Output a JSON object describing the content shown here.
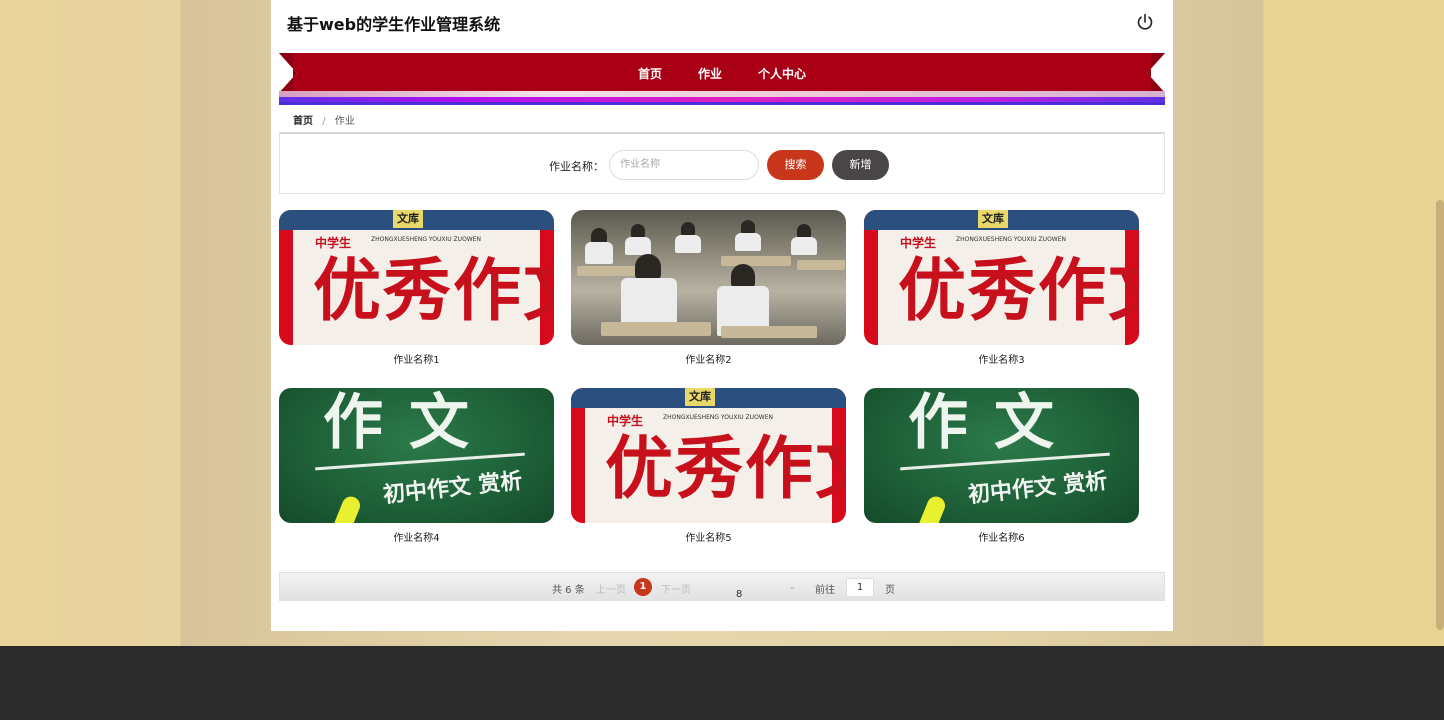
{
  "app": {
    "title": "基于web的学生作业管理系统"
  },
  "nav": {
    "items": [
      {
        "label": "首页",
        "active": false
      },
      {
        "label": "作业",
        "active": true
      },
      {
        "label": "个人中心",
        "active": false
      }
    ]
  },
  "breadcrumb": {
    "home": "首页",
    "sep": "/",
    "current": "作业"
  },
  "search": {
    "label": "作业名称：",
    "placeholder": "作业名称",
    "search_label": "搜索",
    "add_label": "新增"
  },
  "items": [
    {
      "caption": "作业名称1",
      "thumb": "red-book"
    },
    {
      "caption": "作业名称2",
      "thumb": "classroom-photo"
    },
    {
      "caption": "作业名称3",
      "thumb": "red-book"
    },
    {
      "caption": "作业名称4",
      "thumb": "green-chalkboard"
    },
    {
      "caption": "作业名称5",
      "thumb": "red-book"
    },
    {
      "caption": "作业名称6",
      "thumb": "green-chalkboard"
    }
  ],
  "thumb_text": {
    "red_small": "中学生",
    "red_sub": "ZHONGXUESHENG YOUXIU ZUOWEN",
    "red_big": "优秀作文",
    "red_logo": "文库",
    "green_big": "作文",
    "green_sub": "初中作文 赏析"
  },
  "pager": {
    "total": "共 6 条",
    "prev": "上一页",
    "current": "1",
    "next": "下一页",
    "page_size": "8",
    "goto": "前往",
    "jump_value": "1",
    "unit": "页"
  },
  "colors": {
    "ribbon": "#a90015",
    "search_button": "#c8361b",
    "add_button": "#4a4646"
  },
  "icons": {
    "logout": "power-icon"
  }
}
